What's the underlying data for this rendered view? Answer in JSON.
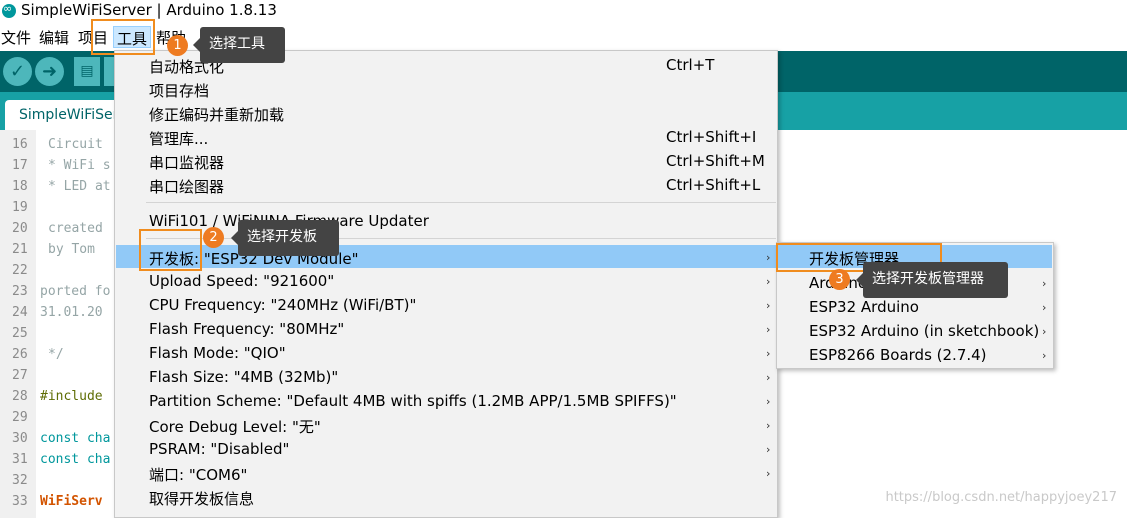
{
  "window": {
    "title": "SimpleWiFiServer | Arduino 1.8.13"
  },
  "menubar": {
    "items": [
      "文件",
      "编辑",
      "项目",
      "工具",
      "帮助"
    ]
  },
  "toolbar": {
    "icons": [
      "verify-icon",
      "upload-icon",
      "new-icon"
    ]
  },
  "tab": {
    "label": "SimpleWiFiSer"
  },
  "editor": {
    "lines": [
      {
        "n": "16",
        "text": "Circuit"
      },
      {
        "n": "17",
        "text": "* WiFi s"
      },
      {
        "n": "18",
        "text": "* LED at"
      },
      {
        "n": "19",
        "text": ""
      },
      {
        "n": "20",
        "text": "created"
      },
      {
        "n": "21",
        "text": "by Tom"
      },
      {
        "n": "22",
        "text": ""
      },
      {
        "n": "23",
        "text": "ported fo"
      },
      {
        "n": "24",
        "text": "31.01.20"
      },
      {
        "n": "25",
        "text": ""
      },
      {
        "n": "26",
        "text": "*/"
      },
      {
        "n": "27",
        "text": ""
      },
      {
        "n": "28",
        "text": "#include"
      },
      {
        "n": "29",
        "text": ""
      },
      {
        "n": "30",
        "text": "const cha"
      },
      {
        "n": "31",
        "text": "const cha"
      },
      {
        "n": "32",
        "text": ""
      },
      {
        "n": "33",
        "text": "WiFiServ"
      }
    ]
  },
  "tools_menu": {
    "items": [
      {
        "label": "自动格式化",
        "shortcut": "Ctrl+T"
      },
      {
        "label": "项目存档",
        "shortcut": ""
      },
      {
        "label": "修正编码并重新加载",
        "shortcut": ""
      },
      {
        "label": "管理库...",
        "shortcut": "Ctrl+Shift+I"
      },
      {
        "label": "串口监视器",
        "shortcut": "Ctrl+Shift+M"
      },
      {
        "label": "串口绘图器",
        "shortcut": "Ctrl+Shift+L"
      },
      {
        "label": "WiFi101 / WiFiNINA Firmware Updater",
        "shortcut": ""
      },
      {
        "label": "开发板: \"ESP32 Dev Module\"",
        "shortcut": ""
      },
      {
        "label": "Upload Speed: \"921600\"",
        "shortcut": ""
      },
      {
        "label": "CPU Frequency: \"240MHz (WiFi/BT)\"",
        "shortcut": ""
      },
      {
        "label": "Flash Frequency: \"80MHz\"",
        "shortcut": ""
      },
      {
        "label": "Flash Mode: \"QIO\"",
        "shortcut": ""
      },
      {
        "label": "Flash Size: \"4MB (32Mb)\"",
        "shortcut": ""
      },
      {
        "label": "Partition Scheme: \"Default 4MB with spiffs (1.2MB APP/1.5MB SPIFFS)\"",
        "shortcut": ""
      },
      {
        "label": "Core Debug Level: \"无\"",
        "shortcut": ""
      },
      {
        "label": "PSRAM: \"Disabled\"",
        "shortcut": ""
      },
      {
        "label": "端口: \"COM6\"",
        "shortcut": ""
      },
      {
        "label": "取得开发板信息",
        "shortcut": ""
      }
    ]
  },
  "board_submenu": {
    "items": [
      "开发板管理器...",
      "Arduino",
      "ESP32 Arduino",
      "ESP32 Arduino (in sketchbook)",
      "ESP8266 Boards (2.7.4)"
    ]
  },
  "annotations": [
    {
      "number": "1",
      "text": "选择工具"
    },
    {
      "number": "2",
      "text": "选择开发板"
    },
    {
      "number": "3",
      "text": "选择开发板管理器"
    }
  ],
  "watermark": "https://blog.csdn.net/happyjoey217",
  "colors": {
    "toolbar": "#006468",
    "tabbar": "#17a1a5",
    "highlight": "#91c9f7",
    "annotation": "#f08c1e"
  }
}
